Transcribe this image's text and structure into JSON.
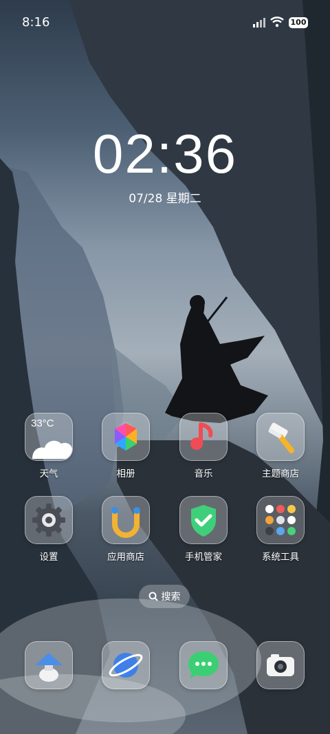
{
  "status_bar": {
    "time": "8:16",
    "battery": "100"
  },
  "lockclock": {
    "time": "02:36",
    "date": "07/28 星期二"
  },
  "weather": {
    "temp": "33°C"
  },
  "apps_row1": [
    {
      "label": "天气",
      "icon": "weather-icon"
    },
    {
      "label": "相册",
      "icon": "gallery-icon"
    },
    {
      "label": "音乐",
      "icon": "music-icon"
    },
    {
      "label": "主题商店",
      "icon": "theme-store-icon"
    }
  ],
  "apps_row2": [
    {
      "label": "设置",
      "icon": "settings-icon"
    },
    {
      "label": "应用商店",
      "icon": "app-store-icon"
    },
    {
      "label": "手机管家",
      "icon": "security-icon"
    },
    {
      "label": "系统工具",
      "icon": "system-tools-folder-icon"
    }
  ],
  "search": {
    "label": "搜索"
  },
  "dock": [
    {
      "icon": "browser-lamp-icon"
    },
    {
      "icon": "browser-planet-icon"
    },
    {
      "icon": "messages-icon"
    },
    {
      "icon": "camera-icon"
    }
  ]
}
